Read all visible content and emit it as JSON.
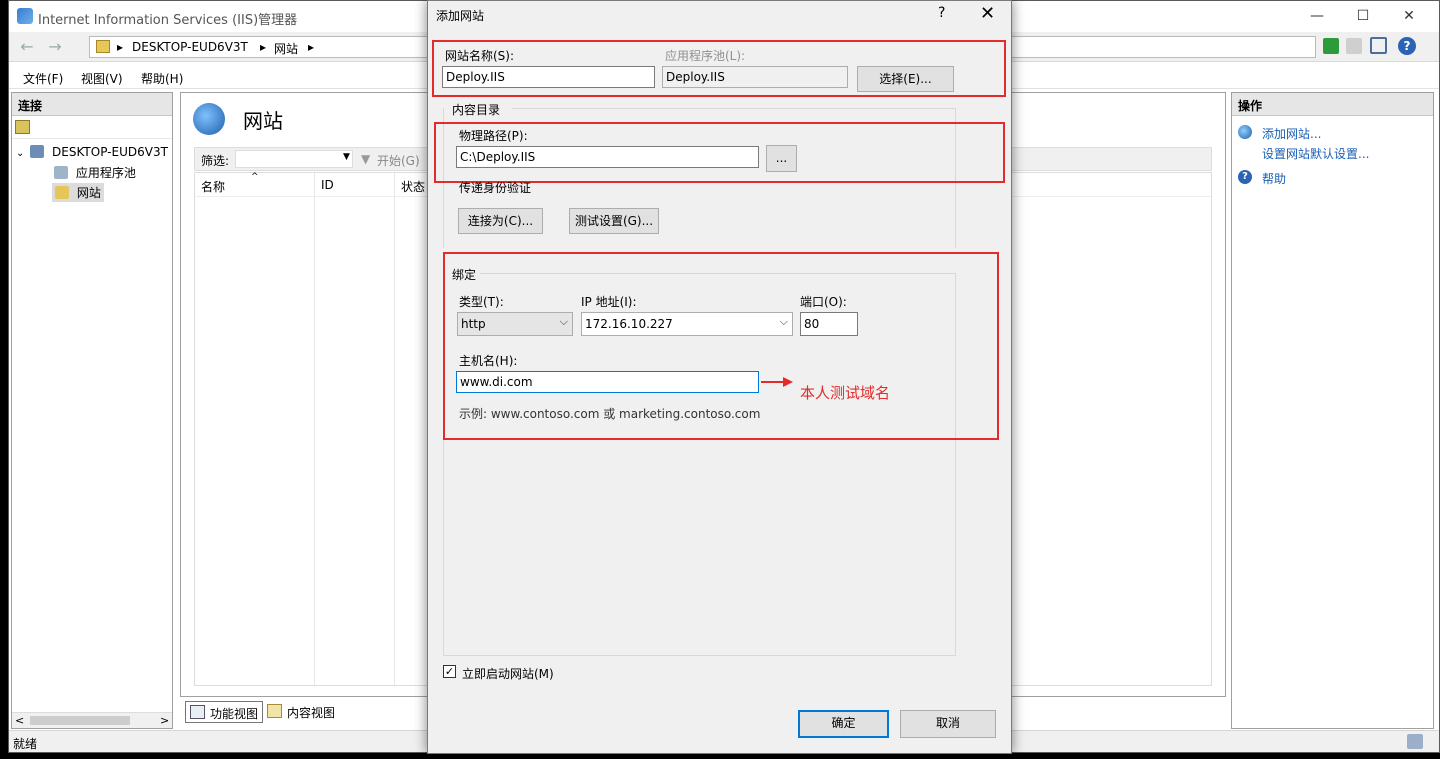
{
  "window": {
    "title": "Internet Information Services (IIS)管理器",
    "minimize": "—",
    "maximize": "☐",
    "close": "✕"
  },
  "address": {
    "crumbs": [
      "DESKTOP-EUD6V3T",
      "网站"
    ],
    "sep": "▸"
  },
  "menu": [
    "文件(F)",
    "视图(V)",
    "帮助(H)"
  ],
  "left_panel": {
    "header": "连接",
    "tree": [
      {
        "label": "DESKTOP-EUD6V3T",
        "expander": "⌄"
      },
      {
        "label": "应用程序池"
      },
      {
        "label": "网站"
      }
    ],
    "scroll_left": "<",
    "scroll_right": ">"
  },
  "center": {
    "title": "网站",
    "filter_label": "筛选:",
    "start_label": "开始(G)",
    "columns": [
      "名称",
      "ID",
      "状态"
    ],
    "tabs": [
      "功能视图",
      "内容视图"
    ]
  },
  "right_panel": {
    "header": "操作",
    "actions": [
      "添加网站...",
      "设置网站默认设置...",
      "帮助"
    ]
  },
  "status": "就绪",
  "dialog": {
    "title": "添加网站",
    "help": "?",
    "close": "✕",
    "site_name_label": "网站名称(S):",
    "site_name_value": "Deploy.IIS",
    "app_pool_label": "应用程序池(L):",
    "app_pool_value": "Deploy.IIS",
    "select_button": "选择(E)...",
    "content_dir_label": "内容目录",
    "physical_path_label": "物理路径(P):",
    "physical_path_value": "C:\\Deploy.IIS",
    "browse_button": "...",
    "passthrough_label": "传递身份验证",
    "connect_as_button": "连接为(C)...",
    "test_settings_button": "测试设置(G)...",
    "binding_label": "绑定",
    "type_label": "类型(T):",
    "type_value": "http",
    "ip_label": "IP 地址(I):",
    "ip_value": "172.16.10.227",
    "port_label": "端口(O):",
    "port_value": "80",
    "host_label": "主机名(H):",
    "host_value": "www.di.com",
    "example": "示例: www.contoso.com 或 marketing.contoso.com",
    "annotation": "本人测试域名",
    "start_now_label": "立即启动网站(M)",
    "start_now_checked": true,
    "ok_button": "确定",
    "cancel_button": "取消"
  },
  "colors": {
    "highlight": "#e32b2b",
    "link": "#1a5fb4",
    "focus": "#0078d7"
  }
}
